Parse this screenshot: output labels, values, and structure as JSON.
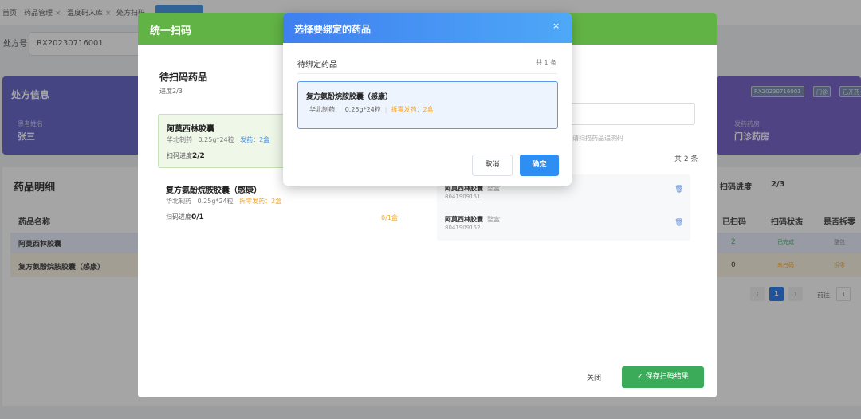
{
  "nav_tabs": [
    {
      "label": "首页"
    },
    {
      "label": "药品管理"
    },
    {
      "label": "温度码入库"
    },
    {
      "label": "处方扫码"
    }
  ],
  "prescription": {
    "label": "处方号",
    "value": "RX20230716001"
  },
  "info_card": {
    "title": "处方信息",
    "patient_label": "患者姓名",
    "patient_value": "张三",
    "chips": [
      "RX20230716001",
      "门诊",
      "已开药"
    ],
    "pharmacy_label": "发药药房",
    "pharmacy_value": "门诊药房"
  },
  "detail": {
    "title": "药品明细",
    "progress_label": "扫码进度",
    "progress_value": "2/3",
    "headers": {
      "name": "药品名称",
      "scanned": "已扫码",
      "status": "扫码状态",
      "split": "是否拆零"
    },
    "rows": [
      {
        "name": "阿莫西林胶囊",
        "scanned": "2",
        "status": "已完成",
        "split": "整包"
      },
      {
        "name": "复方氨酚烷胺胶囊（感康）",
        "scanned": "0",
        "status": "未扫码",
        "split": "拆零"
      }
    ],
    "pagination": {
      "prev": "‹",
      "page": "1",
      "next": "›",
      "goto_label": "前往",
      "goto_value": "1"
    }
  },
  "scan_dialog": {
    "title": "统一扫码",
    "pending_title": "待扫码药品",
    "progress": "进度2/3",
    "cards": [
      {
        "name": "阿莫西林胶囊",
        "maker": "华北制药",
        "spec": "0.25g*24粒",
        "dispense": "发药：2盒",
        "progress_label": "扫码进度",
        "progress_value": "2/2"
      },
      {
        "name": "复方氨酚烷胺胶囊（感康）",
        "maker": "华北制药",
        "spec": "0.25g*24粒",
        "dispense": "拆零发药：2盒",
        "progress_label": "扫码进度",
        "progress_value": "0/1",
        "badge": "0/1盒"
      }
    ],
    "scan_hint": "请扫描药品追溯码",
    "total": "共 2 条",
    "scanned_items": [
      {
        "name": "阿莫西林胶囊",
        "tag": "整盒",
        "code": "8041909151"
      },
      {
        "name": "阿莫西林胶囊",
        "tag": "整盒",
        "code": "8041909152"
      }
    ],
    "close_label": "关闭",
    "save_label": "保存扫码结果"
  },
  "bind_dialog": {
    "title": "选择要绑定的药品",
    "close_glyph": "×",
    "subtitle": "待绑定药品",
    "count": "共 1 条",
    "item": {
      "name": "复方氨酚烷胺胶囊（感康）",
      "maker": "华北制药",
      "spec": "0.25g*24粒",
      "dispense": "拆零发药：2盒"
    },
    "cancel_label": "取消",
    "confirm_label": "确定"
  },
  "colors": {
    "scan_header": "#62b345",
    "bind_header": "#3f7ff0",
    "primary_button": "#2f8ef2",
    "save_button": "#3bab5a",
    "warning_text": "#f5a623"
  }
}
